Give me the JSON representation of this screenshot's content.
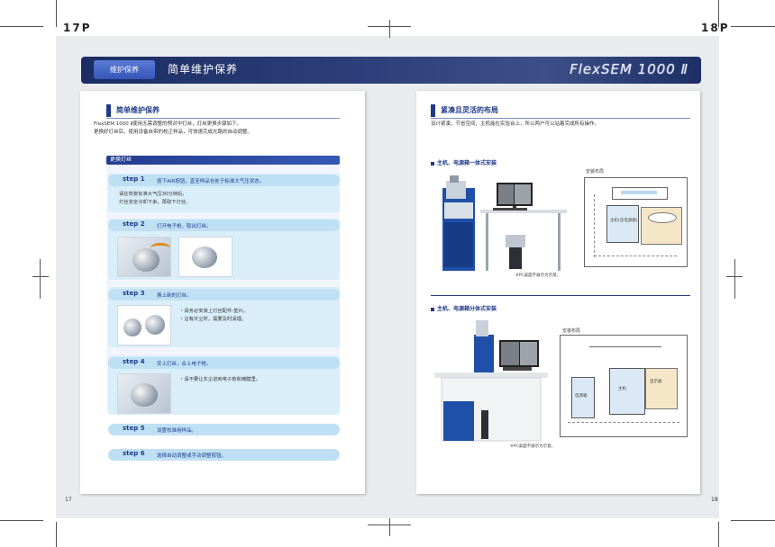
{
  "top_left_page": "17P",
  "top_right_page": "18P",
  "banner": {
    "tag": "维护保养",
    "title": "简单维护保养",
    "logo": "FlexSEM 1000 Ⅱ"
  },
  "left": {
    "section_title": "简单维护保养",
    "intro_1": "FlexSEM 1000 Ⅱ使用无需调整的预对中灯丝，灯丝更换步骤如下。",
    "intro_2": "更换好灯丝后，使用设备自带的校正样品，可快速完成光路的自动调整。",
    "steps_title": "更换灯丝",
    "steps": [
      {
        "label": "step 1",
        "desc": "按下AIR按钮，直至样品仓处于标准大气压状态。"
      },
      {
        "label": "step 2",
        "desc": "打开电子枪，取出灯丝。"
      },
      {
        "label": "step 3",
        "desc": "换上新的灯丝。"
      },
      {
        "label": "step 4",
        "desc": "安上灯丝，合上电子枪。"
      },
      {
        "label": "step 5",
        "desc": "设置校准用样品。"
      },
      {
        "label": "step 6",
        "desc": "选择自动调整或手动调整按钮。"
      }
    ],
    "step1_note_1": "请在恢复标准大气压30分钟后，",
    "step1_note_2": "灯丝完全冷却下来，再取下灯丝。",
    "step3_note_1": "・请务必安装上灯丝配件-垫片。",
    "step3_note_2": "・沾有灰尘时，需要及时清理。",
    "step4_note": "・请不要让灰尘进到电子枪和镀膜里。",
    "page_number": "17"
  },
  "right": {
    "section_title": "紧凑且灵活的布局",
    "intro": "设计紧凑，节省空间，主机能在实验台上，所以两户可以站着完成所有操作。",
    "sub1": "主机、电源箱一体式安装",
    "sub2": "主机、电源箱分体式安装",
    "layout_label_1": "安装布局",
    "layout_label_2": "安装布局",
    "caption_1": "※PC桌面不展示为示意。",
    "caption_2": "※PC桌面不展示为示意。",
    "box_label_main": "主机(含电源箱)",
    "box_label_power": "电源箱",
    "box_label_main2": "主机",
    "box_label_pc": "显示器",
    "page_number": "18"
  }
}
